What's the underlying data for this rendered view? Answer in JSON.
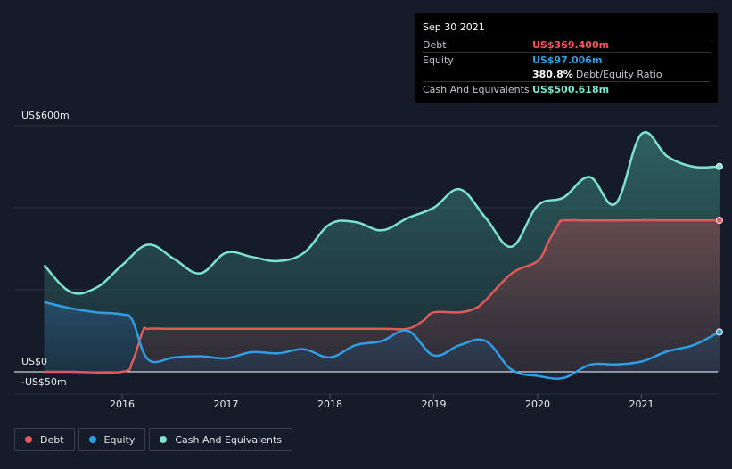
{
  "tooltip": {
    "date": "Sep 30 2021",
    "debt_label": "Debt",
    "debt_value": "US$369.400m",
    "equity_label": "Equity",
    "equity_value": "US$97.006m",
    "ratio_value": "380.8%",
    "ratio_label": "Debt/Equity Ratio",
    "cash_label": "Cash And Equivalents",
    "cash_value": "US$500.618m"
  },
  "legend": [
    {
      "label": "Debt",
      "color": "#e05a5a"
    },
    {
      "label": "Equity",
      "color": "#2f9ee4"
    },
    {
      "label": "Cash And Equivalents",
      "color": "#7de3d1"
    }
  ],
  "chart_data": {
    "type": "area",
    "y_top_label": "US$600m",
    "y_zero_label": "US$0",
    "y_bottom_label": "-US$50m",
    "ylim": [
      -50,
      600
    ],
    "x_ticks": [
      "2016",
      "2017",
      "2018",
      "2019",
      "2020",
      "2021"
    ],
    "grid": true,
    "series": [
      {
        "name": "Debt",
        "color": "#e05a5a",
        "points": [
          [
            2015.25,
            0
          ],
          [
            2015.5,
            0
          ],
          [
            2016.0,
            0
          ],
          [
            2016.1,
            25
          ],
          [
            2016.2,
            100
          ],
          [
            2016.25,
            105
          ],
          [
            2016.5,
            105
          ],
          [
            2017.0,
            105
          ],
          [
            2017.5,
            105
          ],
          [
            2018.0,
            105
          ],
          [
            2018.5,
            105
          ],
          [
            2018.75,
            105
          ],
          [
            2018.9,
            125
          ],
          [
            2019.0,
            145
          ],
          [
            2019.25,
            145
          ],
          [
            2019.4,
            155
          ],
          [
            2019.5,
            175
          ],
          [
            2019.75,
            240
          ],
          [
            2020.0,
            270
          ],
          [
            2020.1,
            315
          ],
          [
            2020.2,
            360
          ],
          [
            2020.25,
            369
          ],
          [
            2020.5,
            369
          ],
          [
            2020.75,
            369
          ],
          [
            2021.0,
            369.4
          ],
          [
            2021.25,
            369.4
          ],
          [
            2021.5,
            369.4
          ],
          [
            2021.75,
            369.4
          ]
        ]
      },
      {
        "name": "Equity",
        "color": "#2f9ee4",
        "points": [
          [
            2015.25,
            170
          ],
          [
            2015.5,
            155
          ],
          [
            2015.75,
            145
          ],
          [
            2016.0,
            140
          ],
          [
            2016.1,
            125
          ],
          [
            2016.25,
            30
          ],
          [
            2016.5,
            35
          ],
          [
            2016.75,
            38
          ],
          [
            2017.0,
            33
          ],
          [
            2017.25,
            48
          ],
          [
            2017.5,
            45
          ],
          [
            2017.75,
            55
          ],
          [
            2018.0,
            35
          ],
          [
            2018.25,
            65
          ],
          [
            2018.5,
            75
          ],
          [
            2018.75,
            100
          ],
          [
            2019.0,
            40
          ],
          [
            2019.25,
            65
          ],
          [
            2019.5,
            75
          ],
          [
            2019.75,
            5
          ],
          [
            2020.0,
            -10
          ],
          [
            2020.25,
            -15
          ],
          [
            2020.5,
            17
          ],
          [
            2020.75,
            18
          ],
          [
            2021.0,
            25
          ],
          [
            2021.25,
            50
          ],
          [
            2021.5,
            65
          ],
          [
            2021.75,
            97
          ]
        ]
      },
      {
        "name": "Cash And Equivalents",
        "color": "#7de3d1",
        "points": [
          [
            2015.25,
            260
          ],
          [
            2015.5,
            195
          ],
          [
            2015.75,
            205
          ],
          [
            2016.0,
            260
          ],
          [
            2016.25,
            310
          ],
          [
            2016.5,
            275
          ],
          [
            2016.75,
            240
          ],
          [
            2017.0,
            290
          ],
          [
            2017.25,
            280
          ],
          [
            2017.5,
            270
          ],
          [
            2017.75,
            290
          ],
          [
            2018.0,
            360
          ],
          [
            2018.25,
            365
          ],
          [
            2018.5,
            345
          ],
          [
            2018.75,
            375
          ],
          [
            2019.0,
            400
          ],
          [
            2019.25,
            445
          ],
          [
            2019.5,
            375
          ],
          [
            2019.75,
            305
          ],
          [
            2020.0,
            405
          ],
          [
            2020.25,
            425
          ],
          [
            2020.5,
            475
          ],
          [
            2020.75,
            410
          ],
          [
            2021.0,
            580
          ],
          [
            2021.25,
            525
          ],
          [
            2021.5,
            500
          ],
          [
            2021.75,
            500.618
          ]
        ]
      }
    ]
  }
}
